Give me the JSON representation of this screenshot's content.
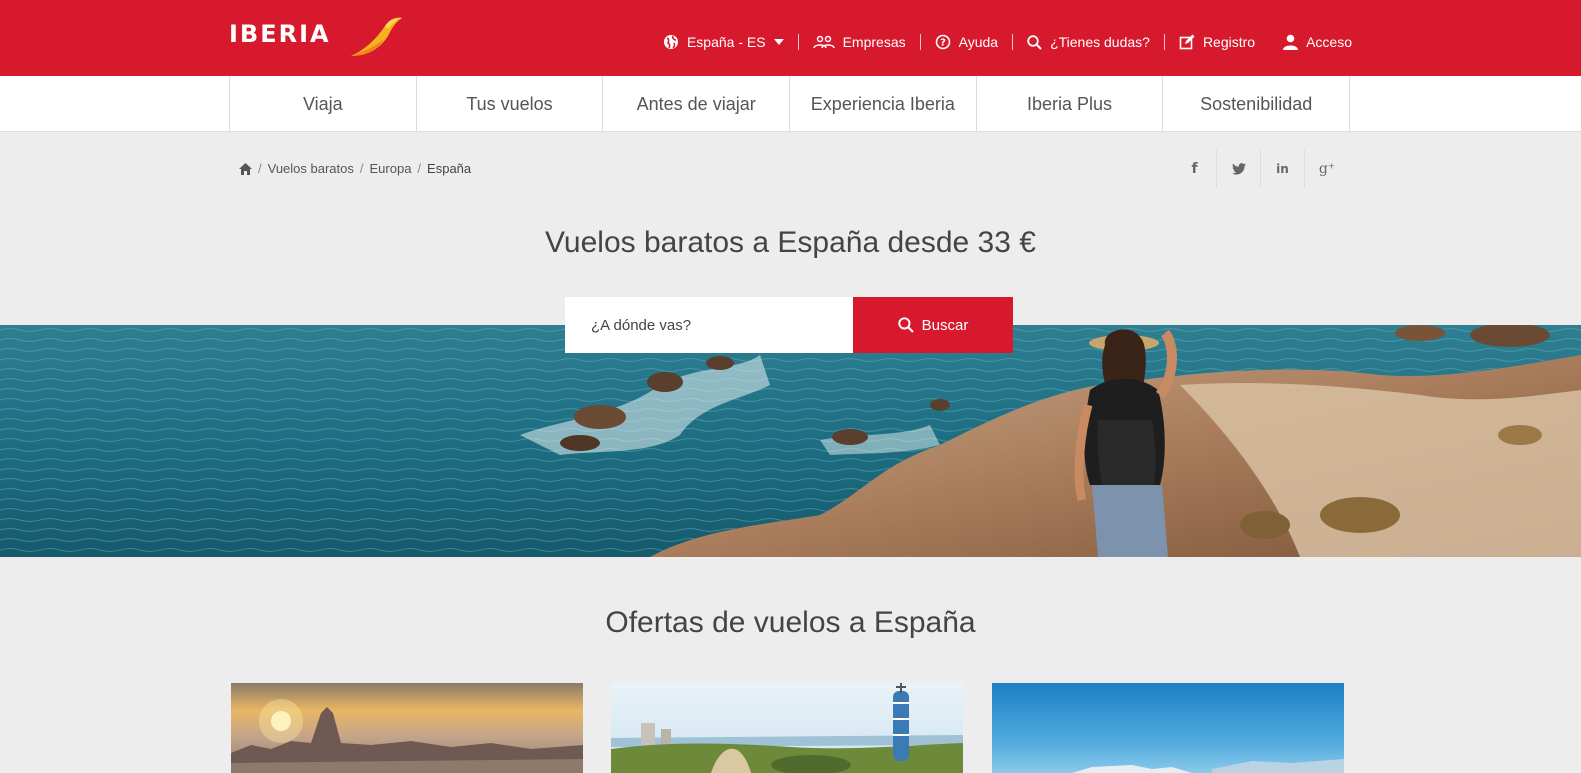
{
  "brand": {
    "name": "IBERIA"
  },
  "topnav": {
    "country": "España - ES",
    "business": "Empresas",
    "help": "Ayuda",
    "questions": "¿Tienes dudas?",
    "register": "Registro",
    "login": "Acceso"
  },
  "mainnav": {
    "tabs": [
      {
        "label": "Viaja"
      },
      {
        "label": "Tus vuelos"
      },
      {
        "label": "Antes de viajar"
      },
      {
        "label": "Experiencia Iberia"
      },
      {
        "label": "Iberia Plus"
      },
      {
        "label": "Sostenibilidad"
      }
    ]
  },
  "breadcrumb": {
    "items": [
      "Vuelos baratos",
      "Europa",
      "España"
    ]
  },
  "social": {
    "facebook": "f",
    "linkedin": "in",
    "google": "g⁺"
  },
  "hero": {
    "title": "Vuelos baratos a España desde 33 €",
    "search_placeholder": "¿A dónde vas?",
    "search_button": "Buscar"
  },
  "offers": {
    "title": "Ofertas de vuelos a España"
  },
  "colors": {
    "brand_red": "#d7192d",
    "background": "#ededed"
  },
  "icons": [
    "globe-icon",
    "people-icon",
    "help-circle-icon",
    "search-icon",
    "edit-icon",
    "user-icon",
    "home-icon",
    "facebook-icon",
    "twitter-icon",
    "linkedin-icon",
    "google-plus-icon"
  ]
}
